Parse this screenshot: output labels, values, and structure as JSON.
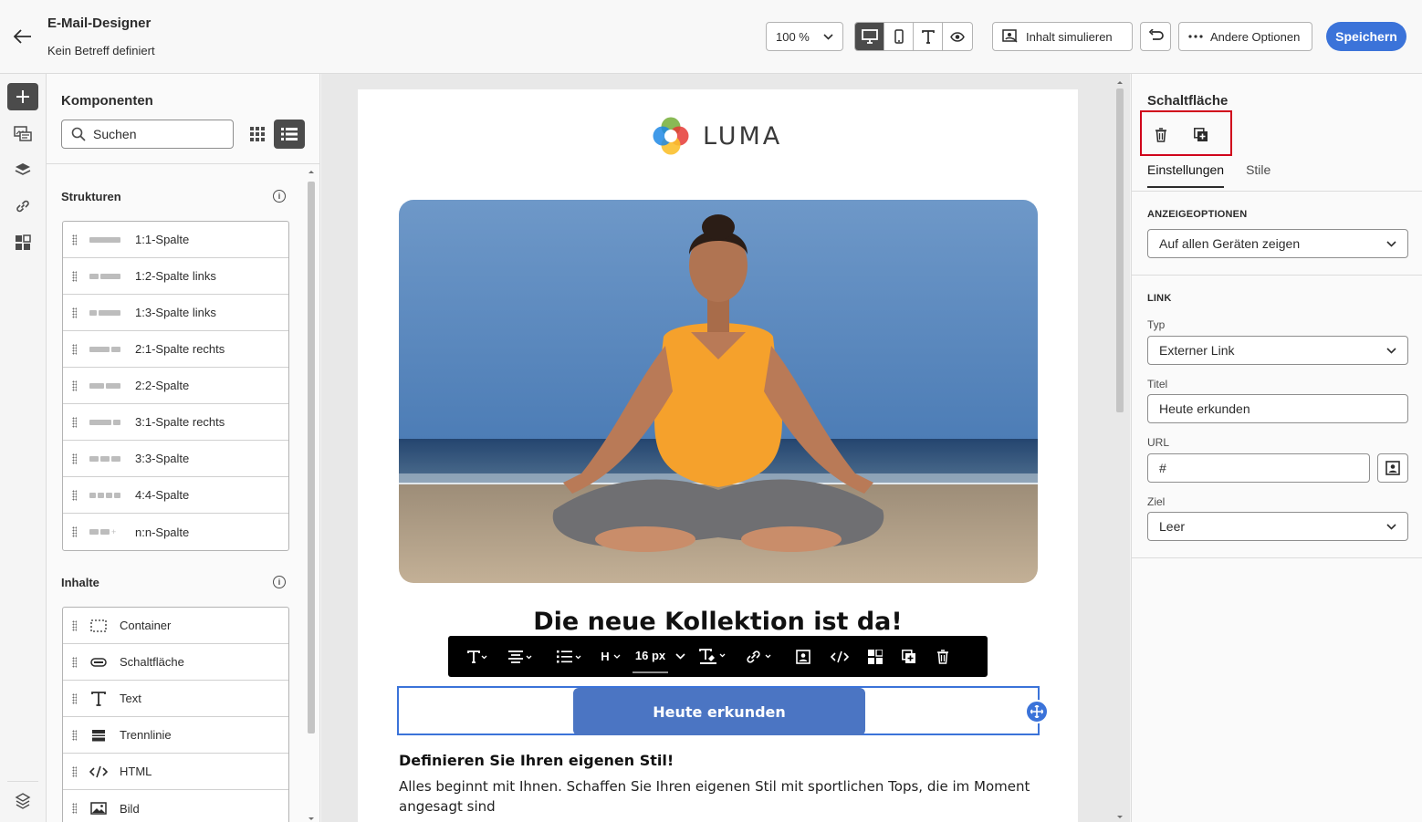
{
  "header": {
    "title": "E-Mail-Designer",
    "subtitle": "Kein Betreff definiert",
    "zoom": "100 %",
    "simulate_label": "Inhalt simulieren",
    "options_label": "Andere Optionen",
    "save_label": "Speichern"
  },
  "components": {
    "title": "Komponenten",
    "search_placeholder": "Suchen",
    "structures_heading": "Strukturen",
    "structures": [
      {
        "label": "1:1-Spalte"
      },
      {
        "label": "1:2-Spalte links"
      },
      {
        "label": "1:3-Spalte links"
      },
      {
        "label": "2:1-Spalte rechts"
      },
      {
        "label": "2:2-Spalte"
      },
      {
        "label": "3:1-Spalte rechts"
      },
      {
        "label": "3:3-Spalte"
      },
      {
        "label": "4:4-Spalte"
      },
      {
        "label": "n:n-Spalte"
      }
    ],
    "contents_heading": "Inhalte",
    "contents": [
      {
        "label": "Container",
        "icon": "container-icon"
      },
      {
        "label": "Schaltfläche",
        "icon": "button-icon"
      },
      {
        "label": "Text",
        "icon": "text-icon"
      },
      {
        "label": "Trennlinie",
        "icon": "divider-icon"
      },
      {
        "label": "HTML",
        "icon": "code-icon"
      },
      {
        "label": "Bild",
        "icon": "image-icon"
      }
    ]
  },
  "email": {
    "logo_text": "LUMA",
    "headline": "Die neue Kollektion ist da!",
    "cta_label": "Heute erkunden",
    "toolbar_font_size": "16 px",
    "toolbar_heading": "H",
    "subheading": "Definieren Sie Ihren eigenen Stil!",
    "body": "Alles beginnt mit Ihnen. Schaffen Sie Ihren eigenen Stil mit sportlichen Tops, die im Moment angesagt sind"
  },
  "properties": {
    "title": "Schaltfläche",
    "tab_settings": "Einstellungen",
    "tab_styles": "Stile",
    "display_caption": "ANZEIGEOPTIONEN",
    "display_value": "Auf allen Geräten zeigen",
    "link_caption": "LINK",
    "type_label": "Typ",
    "type_value": "Externer Link",
    "title_label": "Titel",
    "title_value": "Heute erkunden",
    "url_label": "URL",
    "url_value": "#",
    "target_label": "Ziel",
    "target_value": "Leer"
  },
  "colors": {
    "accent": "#3b73d9",
    "cta": "#4b75c3",
    "highlight": "#d0021b"
  }
}
